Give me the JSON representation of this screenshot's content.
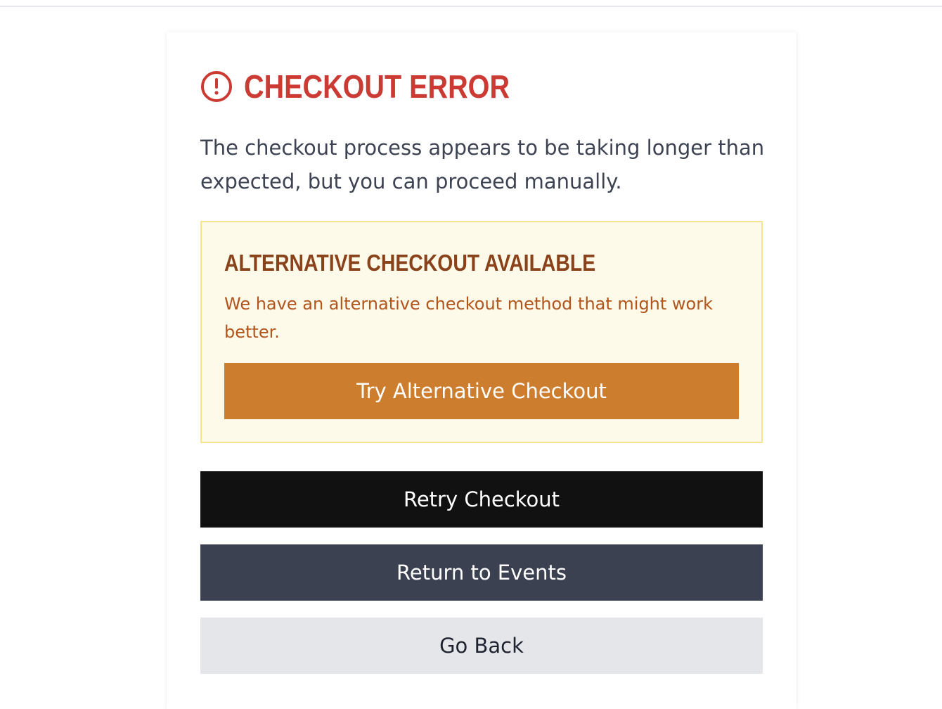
{
  "error": {
    "title": "CHECKOUT ERROR",
    "icon": "alert-circle-icon",
    "message": "The checkout process appears to be taking longer than expected, but you can proceed manually."
  },
  "alternative": {
    "title": "ALTERNATIVE CHECKOUT AVAILABLE",
    "message": "We have an alternative checkout method that might work better.",
    "button_label": "Try Alternative Checkout"
  },
  "actions": {
    "retry_label": "Retry Checkout",
    "return_label": "Return to Events",
    "back_label": "Go Back"
  },
  "colors": {
    "error_red": "#cc3b33",
    "alt_background": "#fefae9",
    "alt_border": "#f6e58e",
    "alt_title": "#8a421b",
    "alt_text": "#b1551c",
    "alt_button": "#cd7d2e",
    "retry_button": "#111111",
    "return_button": "#3b4150",
    "back_button": "#e5e6ea"
  }
}
